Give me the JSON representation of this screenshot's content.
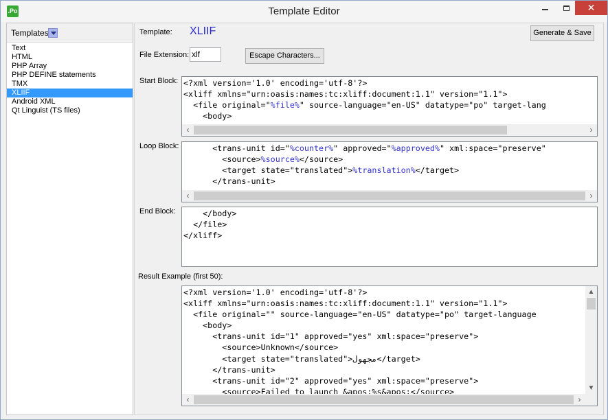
{
  "window": {
    "title": "Template Editor",
    "app_icon": ".Po",
    "min_icon": "minimize-icon",
    "max_icon": "maximize-icon",
    "close_glyph": "✕"
  },
  "left": {
    "header_label": "Templates",
    "templates": [
      "Text",
      "HTML",
      "PHP Array",
      "PHP DEFINE statements",
      "TMX",
      "XLIIF",
      "Android XML",
      "Qt Linguist (TS files)"
    ],
    "selected": "XLIIF"
  },
  "editor": {
    "template_label": "Template:",
    "template_name": "XLIIF",
    "generate_button": "Generate & Save",
    "file_ext_label": "File Extension:",
    "file_ext_value": "xlf",
    "escape_button": "Escape Characters...",
    "start_label": "Start Block:",
    "loop_label": "Loop Block:",
    "end_label": "End Block:",
    "result_label": "Result Example (first 50):",
    "start_lines": [
      "<?xml version='1.0' encoding='utf-8'?>",
      "<xliff xmlns=\"urn:oasis:names:tc:xliff:document:1.1\" version=\"1.1\">",
      "  <file original=\"%file%\" source-language=\"en-US\" datatype=\"po\" target-lang",
      "    <body>"
    ],
    "loop_lines": [
      "      <trans-unit id=\"%counter%\" approved=\"%approved%\" xml:space=\"preserve\"",
      "        <source>%source%</source>",
      "        <target state=\"translated\">%translation%</target>",
      "      </trans-unit>"
    ],
    "end_lines": [
      "    </body>",
      "  </file>",
      "</xliff>"
    ],
    "result_lines": [
      "<?xml version='1.0' encoding='utf-8'?>",
      "<xliff xmlns=\"urn:oasis:names:tc:xliff:document:1.1\" version=\"1.1\">",
      "  <file original=\"\" source-language=\"en-US\" datatype=\"po\" target-language",
      "    <body>",
      "      <trans-unit id=\"1\" approved=\"yes\" xml:space=\"preserve\">",
      "        <source>Unknown</source>",
      "        <target state=\"translated\">مجهول</target>",
      "      </trans-unit>",
      "      <trans-unit id=\"2\" approved=\"yes\" xml:space=\"preserve\">",
      "        <source>Failed to launch &apos;%s&apos;</source>"
    ]
  },
  "colors": {
    "selection": "#3399ff",
    "template_name": "#2a2ac8",
    "variable": "#3232c8",
    "close_button": "#c7413a"
  }
}
